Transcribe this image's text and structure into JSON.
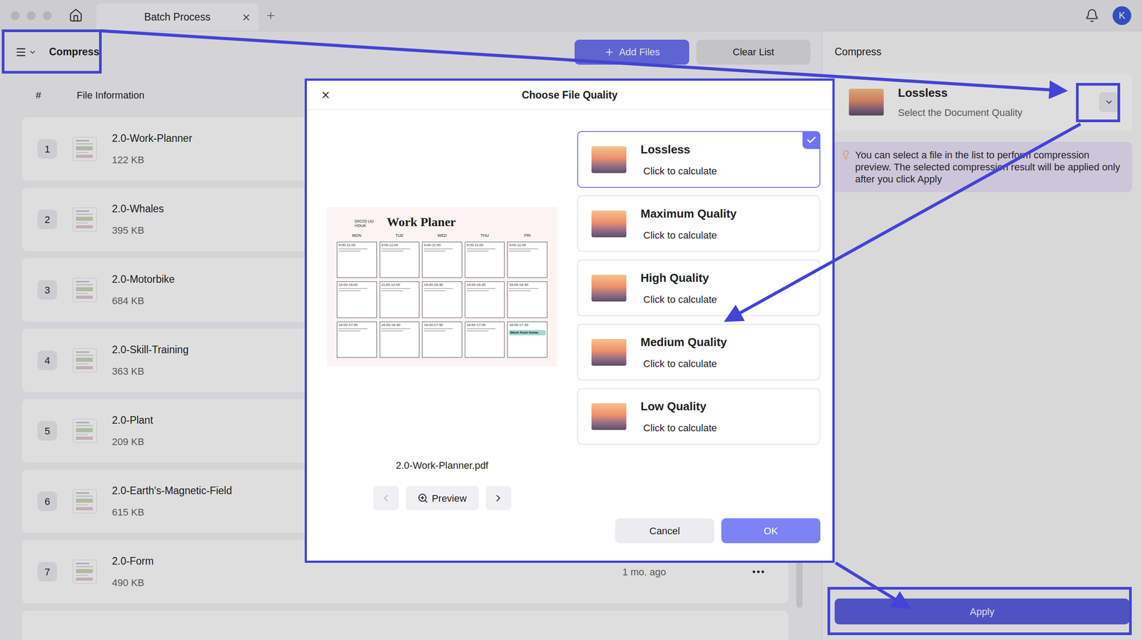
{
  "window": {
    "tab": "Batch Process",
    "avatar": "K"
  },
  "toolbar": {
    "mode": "Compress",
    "add_files": "Add Files",
    "clear_list": "Clear List"
  },
  "file_list": {
    "columns": [
      "#",
      "File Information"
    ],
    "rows": [
      {
        "index": "1",
        "name": "2.0-Work-Planner",
        "size": "122 KB"
      },
      {
        "index": "2",
        "name": "2.0-Whales",
        "size": "395 KB"
      },
      {
        "index": "3",
        "name": "2.0-Motorbike",
        "size": "684 KB"
      },
      {
        "index": "4",
        "name": "2.0-Skill-Training",
        "size": "363 KB"
      },
      {
        "index": "5",
        "name": "2.0-Plant",
        "size": "209 KB"
      },
      {
        "index": "6",
        "name": "2.0-Earth's-Magnetic-Field",
        "size": "615 KB"
      },
      {
        "index": "7",
        "name": "2.0-Form",
        "size": "490 KB",
        "modified": "1 mo. ago"
      }
    ]
  },
  "side_panel": {
    "title": "Compress",
    "quality": "Lossless",
    "hint": "Select the Document Quality",
    "tip": "You can select a file in the list to perform compression preview. The selected compression result will be applied only after you click Apply",
    "apply": "Apply"
  },
  "dialog": {
    "title": "Choose File Quality",
    "options": [
      {
        "name": "Lossless",
        "hint": "Click to calculate",
        "selected": true
      },
      {
        "name": "Maximum Quality",
        "hint": "Click to calculate",
        "selected": false
      },
      {
        "name": "High Quality",
        "hint": "Click to calculate",
        "selected": false
      },
      {
        "name": "Medium Quality",
        "hint": "Click to calculate",
        "selected": false
      },
      {
        "name": "Low Quality",
        "hint": "Click to calculate",
        "selected": false
      }
    ],
    "document": {
      "title": "Work Planer",
      "subtitle": "(0ICO) UU HOUK",
      "days": [
        "MON",
        "TUE",
        "WED",
        "THU",
        "FRI"
      ],
      "slots": [
        [
          "9:00-11:00",
          "9:00-11:00",
          "9:00-11:00",
          "9:00-11:00",
          "9:00-11:00"
        ],
        [
          "15:00-16:00",
          "11:00-12:00",
          "15:00-16:30",
          "15:00-16:30",
          "15:00-16:30"
        ],
        [
          "16:00-17:30",
          "16:00-16:30",
          "16:00-17:30",
          "16:00-17:30",
          "16:00-17:30"
        ]
      ],
      "note": "Work from home"
    },
    "file": "2.0-Work-Planner.pdf",
    "preview": "Preview",
    "prev_disabled": true,
    "next_disabled": false,
    "cancel": "Cancel",
    "ok": "OK"
  }
}
